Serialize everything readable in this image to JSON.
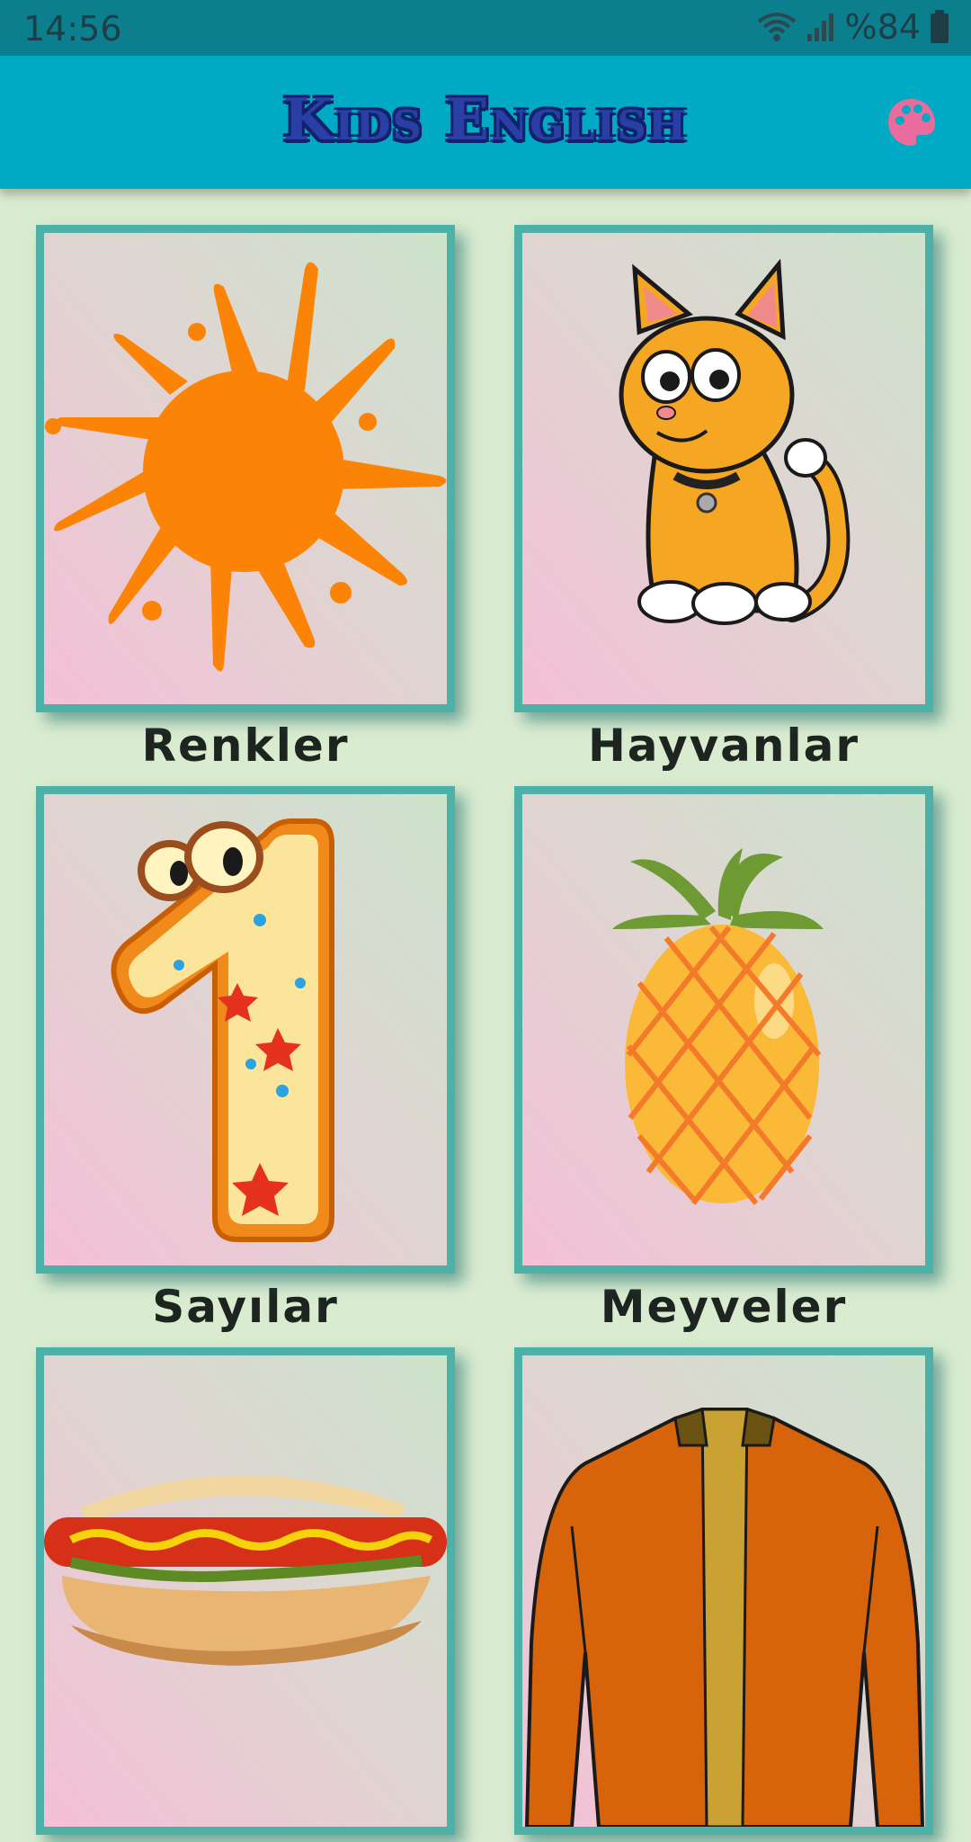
{
  "status_bar": {
    "time": "14:56",
    "battery": "%84"
  },
  "app_bar": {
    "title": "Kids English",
    "palette_icon": "palette-icon",
    "accent_color": "#00a9c4"
  },
  "categories": [
    {
      "label": "Renkler",
      "icon": "paint-splash-icon"
    },
    {
      "label": "Hayvanlar",
      "icon": "cat-icon"
    },
    {
      "label": "Sayılar",
      "icon": "number-one-icon"
    },
    {
      "label": "Meyveler",
      "icon": "pineapple-icon"
    },
    {
      "label": "",
      "icon": "hotdog-icon"
    },
    {
      "label": "",
      "icon": "jacket-icon"
    }
  ]
}
